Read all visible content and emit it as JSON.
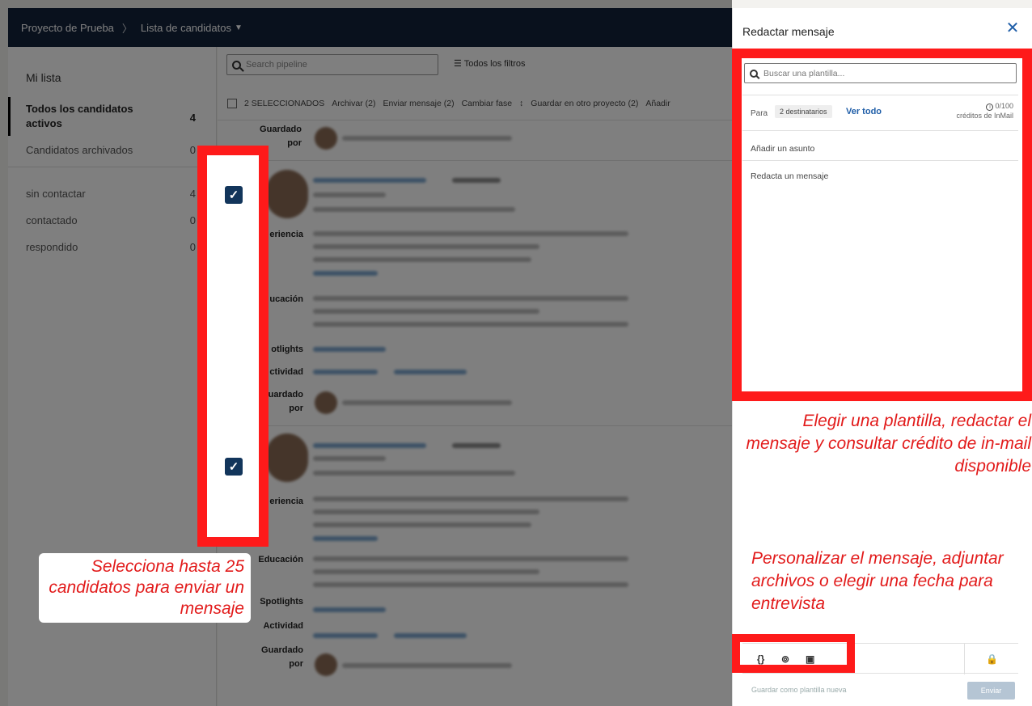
{
  "header": {
    "project": "Proyecto de Prueba",
    "separator": "〉",
    "list": "Lista de candidatos"
  },
  "sidebar": {
    "title": "Mi lista",
    "items": [
      {
        "label": "Todos los candidatos activos",
        "count": "4"
      },
      {
        "label": "Candidatos archivados",
        "count": "0"
      },
      {
        "label": "sin contactar",
        "count": "4"
      },
      {
        "label": "contactado",
        "count": "0"
      },
      {
        "label": "respondido",
        "count": "0"
      }
    ]
  },
  "pipeline": {
    "search_placeholder": "Search pipeline",
    "filters_label": "Todos los filtros",
    "actions": [
      "2 SELECCIONADOS",
      "Archivar (2)",
      "Enviar mensaje (2)",
      "Cambiar fase",
      "Guardar en otro proyecto (2)",
      "Añadir"
    ],
    "labels": {
      "saved_by_1": "Guardado",
      "saved_by_2": "por",
      "experience": "eriencia",
      "education": "ucación",
      "spotlights": "otlights",
      "activity": "ctividad",
      "saved_short": "uardado",
      "education_full": "Educación",
      "spotlights_full": "Spotlights",
      "activity_full": "Actividad",
      "saved_full": "Guardado"
    }
  },
  "annotations": {
    "left_caption": "Selecciona hasta 25 candidatos para enviar un mensaje",
    "right_caption1": "Elegir una plantilla, redactar el mensaje y consultar crédito de in-mail disponible",
    "right_caption2": "Personalizar el mensaje, adjuntar archivos o elegir una fecha para entrevista",
    "check_glyph": "✓"
  },
  "compose": {
    "title": "Redactar mensaje",
    "close_glyph": "✕",
    "template_placeholder": "Buscar una plantilla...",
    "to_label": "Para",
    "recipients": "2 destinatarios",
    "see_all": "Ver todo",
    "credits_count": "0/100",
    "credits_label": "créditos de InMail",
    "subject_placeholder": "Añadir un asunto",
    "body_placeholder": "Redacta un mensaje",
    "save_template": "Guardar como plantilla nueva",
    "send": "Enviar",
    "icons": {
      "variables": "{}",
      "attach": "⊚",
      "calendar": "▣",
      "lock": "🔒"
    }
  }
}
